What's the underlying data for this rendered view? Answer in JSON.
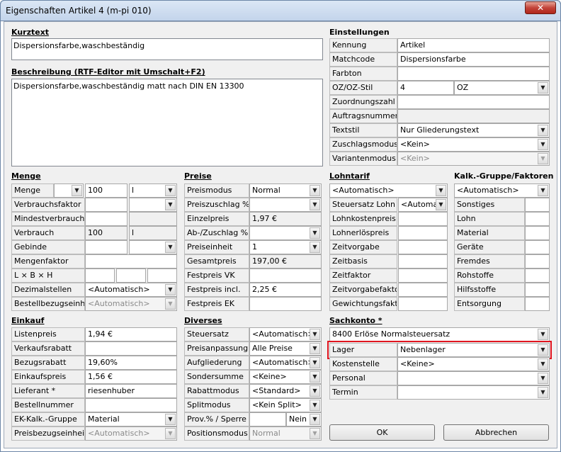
{
  "window": {
    "title": "Eigenschaften Artikel 4 (m-pi 010)",
    "close": "✕"
  },
  "kurztext": {
    "heading": "Kurztext",
    "value": "Dispersionsfarbe,waschbeständig"
  },
  "beschreibung": {
    "heading": "Beschreibung (RTF-Editor mit Umschalt+F2)",
    "value": "Dispersionsfarbe,waschbeständig matt nach DIN EN 13300"
  },
  "einstellungen": {
    "heading": "Einstellungen",
    "kennung_label": "Kennung",
    "kennung": "Artikel",
    "matchcode_label": "Matchcode",
    "matchcode": "Dispersionsfarbe",
    "farbton_label": "Farbton",
    "farbton": "",
    "ozstil_label": "OZ/OZ-Stil",
    "oz_num": "4",
    "oz_stil": "OZ",
    "zuordnung_label": "Zuordnungszahl",
    "zuordnung": "",
    "auftragsnr_label": "Auftragsnummer",
    "auftragsnr": "",
    "textstil_label": "Textstil",
    "textstil": "Nur Gliederungstext",
    "zuschlag_label": "Zuschlagsmodus",
    "zuschlag": "<Kein>",
    "variante_label": "Variantenmodus",
    "variante": "<Kein>"
  },
  "menge": {
    "heading": "Menge",
    "menge_label": "Menge",
    "menge_op": "",
    "menge_val": "100",
    "menge_unit": "l",
    "verbrauchsfaktor_label": "Verbrauchsfaktor",
    "verbrauchsfaktor": "",
    "verbrauchsfaktor_unit": "",
    "mindest_label": "Mindestverbrauch",
    "mindest": "",
    "verbrauch_label": "Verbrauch",
    "verbrauch": "100",
    "verbrauch_unit": "l",
    "gebinde_label": "Gebinde",
    "gebinde": "",
    "gebinde_unit": "",
    "mengenfaktor_label": "Mengenfaktor",
    "mengenfaktor": "",
    "lbh_label": "L × B × H",
    "dezimal_label": "Dezimalstellen",
    "dezimal": "<Automatisch>",
    "bestell_label": "Bestellbezugseinheit",
    "bestell": "<Automatisch>"
  },
  "preise": {
    "heading": "Preise",
    "modus_label": "Preismodus",
    "modus": "Normal",
    "zuschlag_label": "Preiszuschlag %",
    "zuschlag": "",
    "einzel_label": "Einzelpreis",
    "einzel": "1,97 €",
    "abzu_label": "Ab-/Zuschlag %",
    "abzu": "",
    "einheit_label": "Preiseinheit",
    "einheit": "1",
    "gesamt_label": "Gesamtpreis",
    "gesamt": "197,00 €",
    "festvk_label": "Festpreis VK",
    "festvk": "",
    "festincl_label": "Festpreis incl.",
    "festincl": "2,25 €",
    "festek_label": "Festpreis EK",
    "festek": ""
  },
  "lohntarif": {
    "heading": "Lohntarif",
    "tarif": "<Automatisch>",
    "steuer_label": "Steuersatz Lohn",
    "steuer": "<Automat",
    "kosten_label": "Lohnkostenpreis",
    "kosten": "",
    "erloes_label": "Lohnerlöspreis",
    "erloes": "",
    "zeitvorgabe_label": "Zeitvorgabe",
    "zeitvorgabe": "",
    "zeitbasis_label": "Zeitbasis",
    "zeitbasis": "",
    "zeitfaktor_label": "Zeitfaktor",
    "zeitfaktor": "",
    "zvfaktor_label": "Zeitvorgabefaktor",
    "zvfaktor": "",
    "gewicht_label": "Gewichtungsfaktor",
    "gewicht": ""
  },
  "kalk": {
    "heading": "Kalk.-Gruppe/Faktoren",
    "gruppe": "<Automatisch>",
    "rows": [
      "Sonstiges",
      "Lohn",
      "Material",
      "Geräte",
      "Fremdes",
      "Rohstoffe",
      "Hilfsstoffe",
      "Entsorgung"
    ]
  },
  "einkauf": {
    "heading": "Einkauf",
    "listen_label": "Listenpreis",
    "listen": "1,94 €",
    "vkrabatt_label": "Verkaufsrabatt",
    "vkrabatt": "",
    "bezugsrabatt_label": "Bezugsrabatt",
    "bezugsrabatt": "19,60%",
    "ekpreis_label": "Einkaufspreis",
    "ekpreis": "1,56 €",
    "lieferant_label": "Lieferant *",
    "lieferant": "riesenhuber",
    "bestellnr_label": "Bestellnummer",
    "bestellnr": "",
    "ekgruppe_label": "EK-Kalk.-Gruppe",
    "ekgruppe": "Material",
    "pbe_label": "Preisbezugseinheit",
    "pbe": "<Automatisch>"
  },
  "diverses": {
    "heading": "Diverses",
    "steuer_label": "Steuersatz",
    "steuer": "<Automatisch>",
    "anpassung_label": "Preisanpassung",
    "anpassung": "Alle Preise",
    "aufglied_label": "Aufgliederung",
    "aufglied": "<Automatisch>",
    "sonder_label": "Sondersumme",
    "sonder": "<Keine>",
    "rabatt_label": "Rabattmodus",
    "rabatt": "<Standard>",
    "split_label": "Splitmodus",
    "split": "<Kein Split>",
    "prov_label": "Prov.% / Sperre",
    "prov": "",
    "sperre": "Nein",
    "pos_label": "Positionsmodus",
    "pos": "Normal"
  },
  "sachkonto": {
    "heading": "Sachkonto *",
    "konto": "8400 Erlöse Normalsteuersatz",
    "lager_label": "Lager",
    "lager": "Nebenlager",
    "kst_label": "Kostenstelle",
    "kst": "<Keine>",
    "personal_label": "Personal",
    "personal": "",
    "termin_label": "Termin",
    "termin": ""
  },
  "buttons": {
    "ok": "OK",
    "abbrechen": "Abbrechen"
  },
  "colors": {
    "highlight": "#e0151f",
    "title_bg": "#c3d4eb",
    "panel": "#f0f0f0"
  }
}
